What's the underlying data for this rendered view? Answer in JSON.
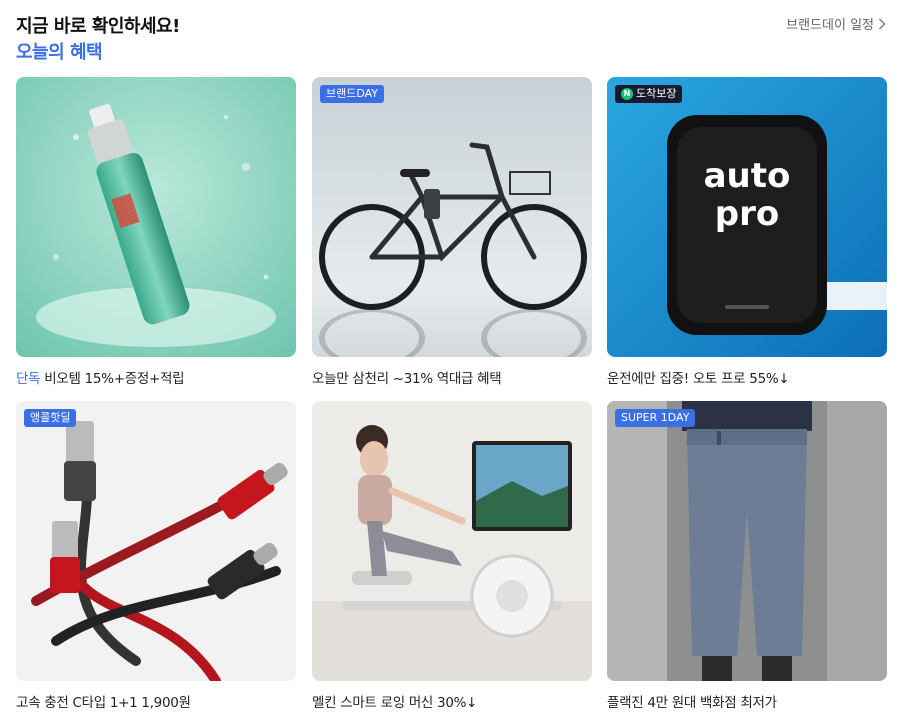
{
  "header": {
    "title": "지금 바로 확인하세요!",
    "subtitle": "오늘의 혜택",
    "link_label": "브랜드데이 일정"
  },
  "cards": [
    {
      "badge": "",
      "prefix": "단독",
      "title": "비오템 15%+증정+적립",
      "image": "green-cosmetic-bottle-splash"
    },
    {
      "badge": "브랜드DAY",
      "prefix": "",
      "title": "오늘만 삼천리 ~31% 역대급 혜택",
      "image": "black-electric-bicycle"
    },
    {
      "badge": "도착보장",
      "badge_icon": "N",
      "prefix": "",
      "title": "운전에만 집중! 오토 프로 55%↓",
      "image": "auto-pro-device",
      "product_text": [
        "auto",
        "pro"
      ]
    },
    {
      "badge": "앵콜핫딜",
      "prefix": "",
      "title": "고속 충전 C타입 1+1 1,900원",
      "image": "braided-usb-c-cables"
    },
    {
      "badge": "",
      "prefix": "",
      "title": "멜킨 스마트 로잉 머신 30%↓",
      "image": "woman-rowing-machine"
    },
    {
      "badge": "SUPER 1DAY",
      "prefix": "",
      "title": "플랙진 4만 원대 백화점 최저가",
      "image": "jeans-on-mannequin"
    }
  ],
  "colors": {
    "accent": "#3b6fe6",
    "title": "#111111",
    "text": "#222222",
    "link": "#666666"
  }
}
